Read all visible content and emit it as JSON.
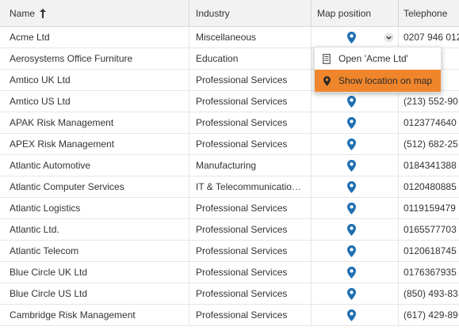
{
  "colors": {
    "accent": "#f0862b",
    "pin": "#1f6fb2"
  },
  "table": {
    "columns": [
      "Name",
      "Industry",
      "Map position",
      "Telephone"
    ],
    "sort": "ascending",
    "rows": [
      {
        "name": "Acme Ltd",
        "industry": "Miscellaneous",
        "phone": "0207 946 012"
      },
      {
        "name": "Aerosystems Office Furniture",
        "industry": "Education",
        "phone": "84"
      },
      {
        "name": "Amtico UK Ltd",
        "industry": "Professional Services",
        "phone": "433"
      },
      {
        "name": "Amtico US Ltd",
        "industry": "Professional Services",
        "phone": "(213) 552-90"
      },
      {
        "name": "APAK Risk Management",
        "industry": "Professional Services",
        "phone": "0123774640"
      },
      {
        "name": "APEX Risk Management",
        "industry": "Professional Services",
        "phone": "(512) 682-25"
      },
      {
        "name": "Atlantic Automotive",
        "industry": "Manufacturing",
        "phone": "0184341388"
      },
      {
        "name": "Atlantic Computer Services",
        "industry": "IT & Telecommunicatio…",
        "phone": "0120480885"
      },
      {
        "name": "Atlantic Logistics",
        "industry": "Professional Services",
        "phone": "0119159479"
      },
      {
        "name": "Atlantic Ltd.",
        "industry": "Professional Services",
        "phone": "0165577703"
      },
      {
        "name": "Atlantic Telecom",
        "industry": "Professional Services",
        "phone": "0120618745"
      },
      {
        "name": "Blue Circle UK Ltd",
        "industry": "Professional Services",
        "phone": "0176367935"
      },
      {
        "name": "Blue Circle US Ltd",
        "industry": "Professional Services",
        "phone": "(850) 493-83"
      },
      {
        "name": "Cambridge Risk Management",
        "industry": "Professional Services",
        "phone": "(617) 429-89"
      }
    ]
  },
  "context_menu": {
    "items": [
      {
        "label": "Open 'Acme Ltd'",
        "icon": "document-icon"
      },
      {
        "label": "Show location on map",
        "icon": "map-pin-icon",
        "active": true
      }
    ]
  }
}
